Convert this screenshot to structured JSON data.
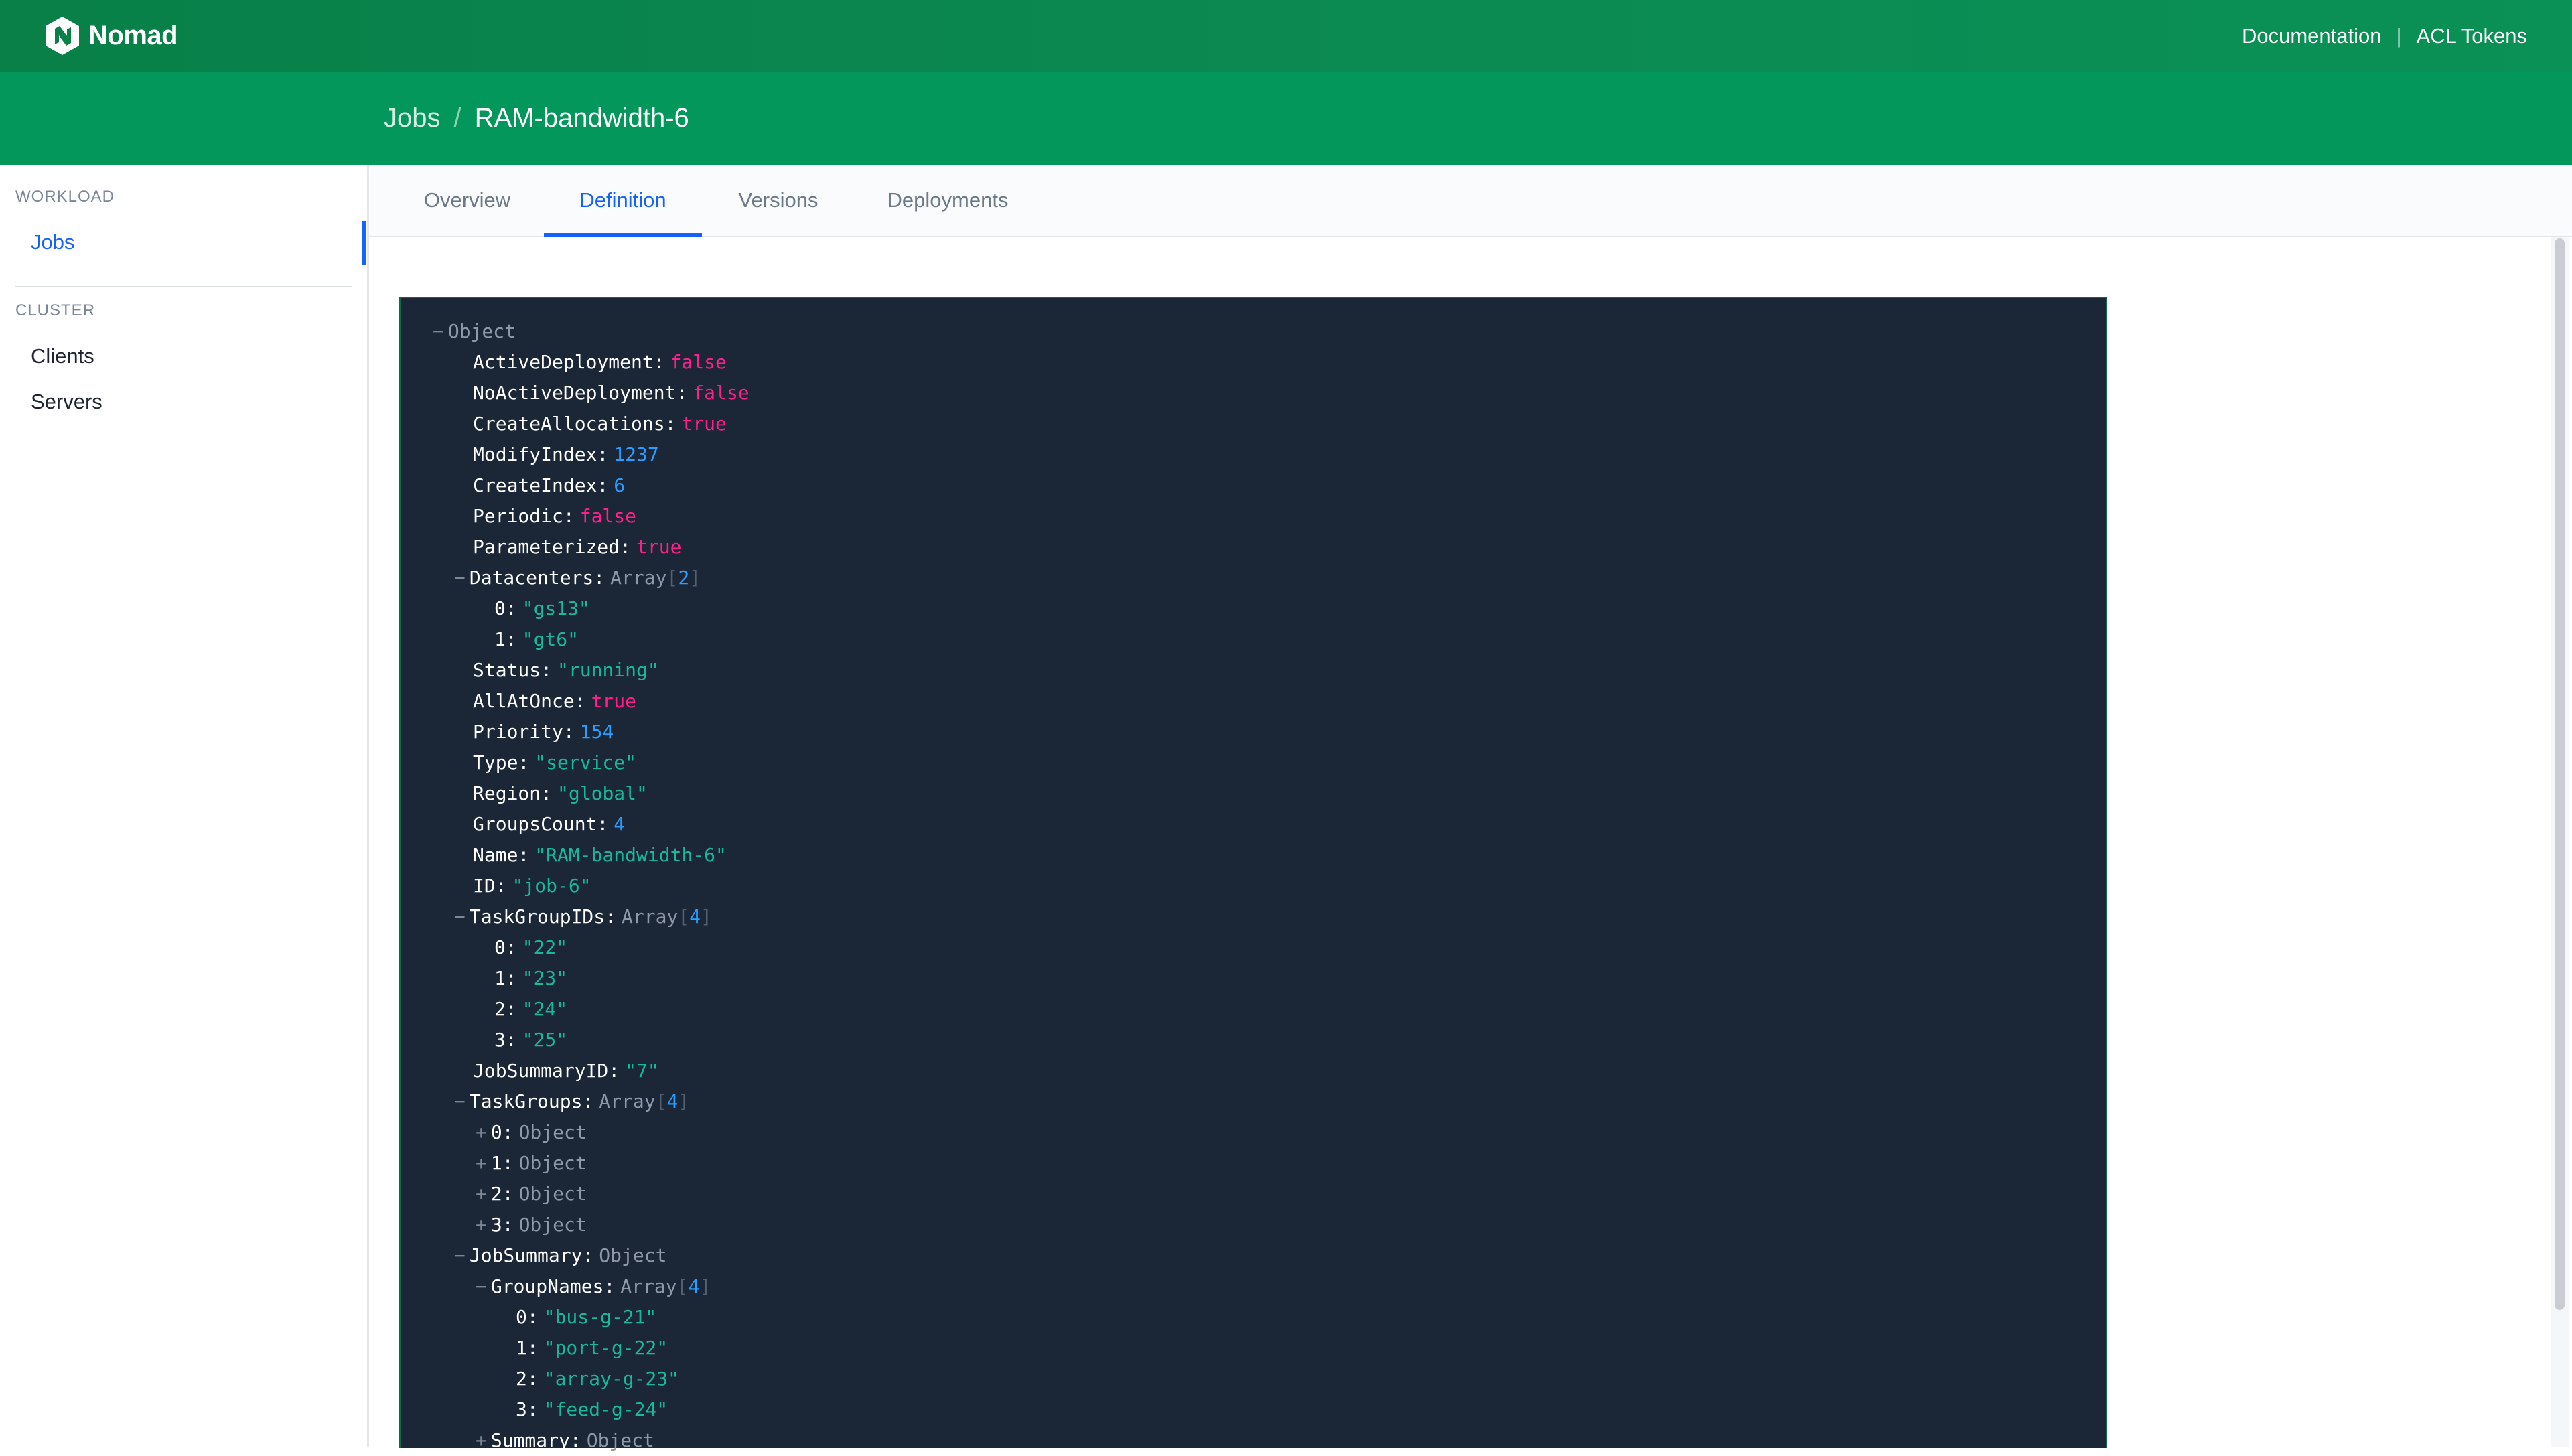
{
  "topbar": {
    "brand": "Nomad",
    "links": [
      "Documentation",
      "ACL Tokens"
    ],
    "separator": "|",
    "color": "#088048"
  },
  "breadcrumb": {
    "parent": "Jobs",
    "separator": "/",
    "current": "RAM-bandwidth-6"
  },
  "sidebar": {
    "sections": [
      {
        "label": "WORKLOAD",
        "items": [
          {
            "label": "Jobs",
            "active": true
          }
        ]
      },
      {
        "label": "CLUSTER",
        "items": [
          {
            "label": "Clients",
            "active": false
          },
          {
            "label": "Servers",
            "active": false
          }
        ]
      }
    ]
  },
  "tabs": [
    {
      "label": "Overview",
      "active": false
    },
    {
      "label": "Definition",
      "active": true
    },
    {
      "label": "Versions",
      "active": false
    },
    {
      "label": "Deployments",
      "active": false
    }
  ],
  "colors": {
    "accent": "#1563ff",
    "panel_bg": "#1b2636",
    "string": "#18b99b",
    "number": "#2a9dff",
    "boolean": "#ff1f8a"
  },
  "definition": {
    "lines": [
      {
        "depth": 0,
        "toggle": "−",
        "key": "",
        "kind": "object",
        "value": "Object"
      },
      {
        "depth": 1,
        "toggle": "",
        "key": "ActiveDeployment",
        "kind": "bool",
        "value": "false"
      },
      {
        "depth": 1,
        "toggle": "",
        "key": "NoActiveDeployment",
        "kind": "bool",
        "value": "false"
      },
      {
        "depth": 1,
        "toggle": "",
        "key": "CreateAllocations",
        "kind": "bool",
        "value": "true"
      },
      {
        "depth": 1,
        "toggle": "",
        "key": "ModifyIndex",
        "kind": "num",
        "value": "1237"
      },
      {
        "depth": 1,
        "toggle": "",
        "key": "CreateIndex",
        "kind": "num",
        "value": "6"
      },
      {
        "depth": 1,
        "toggle": "",
        "key": "Periodic",
        "kind": "bool",
        "value": "false"
      },
      {
        "depth": 1,
        "toggle": "",
        "key": "Parameterized",
        "kind": "bool",
        "value": "true"
      },
      {
        "depth": 1,
        "toggle": "−",
        "key": "Datacenters",
        "kind": "array",
        "value": "Array",
        "length": "2"
      },
      {
        "depth": 2,
        "toggle": "",
        "key": "0",
        "kind": "str",
        "value": "\"gs13\""
      },
      {
        "depth": 2,
        "toggle": "",
        "key": "1",
        "kind": "str",
        "value": "\"gt6\""
      },
      {
        "depth": 1,
        "toggle": "",
        "key": "Status",
        "kind": "str",
        "value": "\"running\""
      },
      {
        "depth": 1,
        "toggle": "",
        "key": "AllAtOnce",
        "kind": "bool",
        "value": "true"
      },
      {
        "depth": 1,
        "toggle": "",
        "key": "Priority",
        "kind": "num",
        "value": "154"
      },
      {
        "depth": 1,
        "toggle": "",
        "key": "Type",
        "kind": "str",
        "value": "\"service\""
      },
      {
        "depth": 1,
        "toggle": "",
        "key": "Region",
        "kind": "str",
        "value": "\"global\""
      },
      {
        "depth": 1,
        "toggle": "",
        "key": "GroupsCount",
        "kind": "num",
        "value": "4"
      },
      {
        "depth": 1,
        "toggle": "",
        "key": "Name",
        "kind": "str",
        "value": "\"RAM-bandwidth-6\""
      },
      {
        "depth": 1,
        "toggle": "",
        "key": "ID",
        "kind": "str",
        "value": "\"job-6\""
      },
      {
        "depth": 1,
        "toggle": "−",
        "key": "TaskGroupIDs",
        "kind": "array",
        "value": "Array",
        "length": "4"
      },
      {
        "depth": 2,
        "toggle": "",
        "key": "0",
        "kind": "str",
        "value": "\"22\""
      },
      {
        "depth": 2,
        "toggle": "",
        "key": "1",
        "kind": "str",
        "value": "\"23\""
      },
      {
        "depth": 2,
        "toggle": "",
        "key": "2",
        "kind": "str",
        "value": "\"24\""
      },
      {
        "depth": 2,
        "toggle": "",
        "key": "3",
        "kind": "str",
        "value": "\"25\""
      },
      {
        "depth": 1,
        "toggle": "",
        "key": "JobSummaryID",
        "kind": "str",
        "value": "\"7\""
      },
      {
        "depth": 1,
        "toggle": "−",
        "key": "TaskGroups",
        "kind": "array",
        "value": "Array",
        "length": "4"
      },
      {
        "depth": 2,
        "toggle": "+",
        "key": "0",
        "kind": "object",
        "value": "Object"
      },
      {
        "depth": 2,
        "toggle": "+",
        "key": "1",
        "kind": "object",
        "value": "Object"
      },
      {
        "depth": 2,
        "toggle": "+",
        "key": "2",
        "kind": "object",
        "value": "Object"
      },
      {
        "depth": 2,
        "toggle": "+",
        "key": "3",
        "kind": "object",
        "value": "Object"
      },
      {
        "depth": 1,
        "toggle": "−",
        "key": "JobSummary",
        "kind": "object",
        "value": "Object"
      },
      {
        "depth": 2,
        "toggle": "−",
        "key": "GroupNames",
        "kind": "array",
        "value": "Array",
        "length": "4"
      },
      {
        "depth": 3,
        "toggle": "",
        "key": "0",
        "kind": "str",
        "value": "\"bus-g-21\""
      },
      {
        "depth": 3,
        "toggle": "",
        "key": "1",
        "kind": "str",
        "value": "\"port-g-22\""
      },
      {
        "depth": 3,
        "toggle": "",
        "key": "2",
        "kind": "str",
        "value": "\"array-g-23\""
      },
      {
        "depth": 3,
        "toggle": "",
        "key": "3",
        "kind": "str",
        "value": "\"feed-g-24\""
      },
      {
        "depth": 2,
        "toggle": "+",
        "key": "Summary",
        "kind": "object",
        "value": "Object"
      }
    ]
  }
}
